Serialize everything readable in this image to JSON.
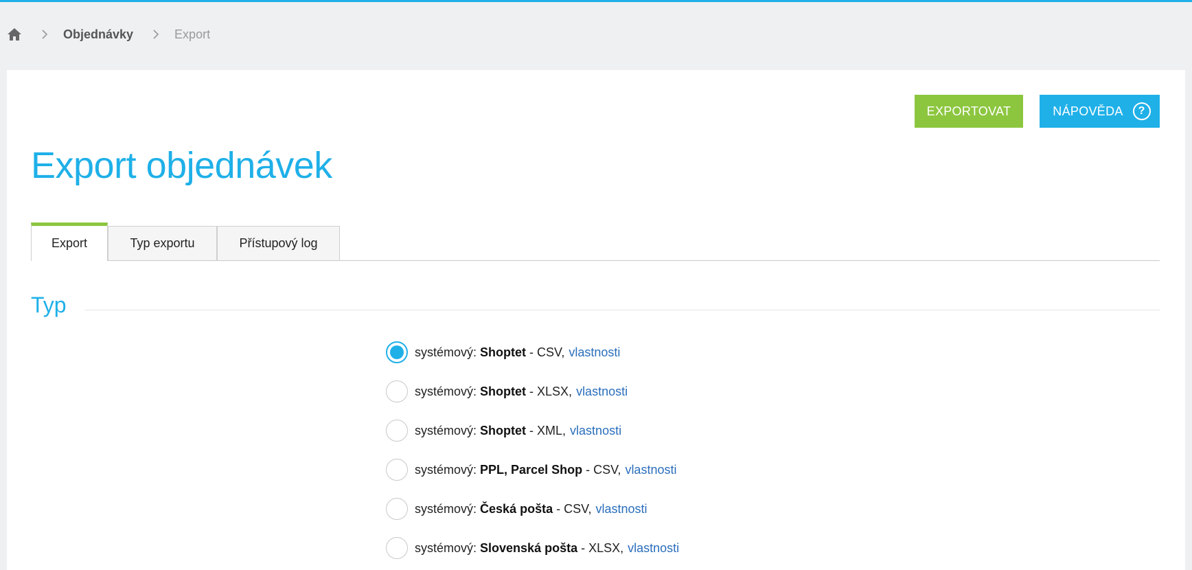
{
  "breadcrumb": {
    "home_icon": "home-icon",
    "items": [
      "Objednávky",
      "Export"
    ]
  },
  "toolbar": {
    "export_label": "EXPORTOVAT",
    "help_label": "NÁPOVĚDA",
    "help_icon": "question-circle-icon"
  },
  "page_title": "Export objednávek",
  "tabs": [
    {
      "label": "Export",
      "active": true
    },
    {
      "label": "Typ exportu",
      "active": false
    },
    {
      "label": "Přístupový log",
      "active": false
    }
  ],
  "section": {
    "title": "Typ",
    "options": [
      {
        "prefix": "systémový:",
        "name": "Shoptet",
        "format": "- CSV,",
        "link": "vlastnosti",
        "selected": true
      },
      {
        "prefix": "systémový:",
        "name": "Shoptet",
        "format": "- XLSX,",
        "link": "vlastnosti",
        "selected": false
      },
      {
        "prefix": "systémový:",
        "name": "Shoptet",
        "format": "- XML,",
        "link": "vlastnosti",
        "selected": false
      },
      {
        "prefix": "systémový:",
        "name": "PPL, Parcel Shop",
        "format": "- CSV,",
        "link": "vlastnosti",
        "selected": false
      },
      {
        "prefix": "systémový:",
        "name": "Česká pošta",
        "format": "- CSV,",
        "link": "vlastnosti",
        "selected": false
      },
      {
        "prefix": "systémový:",
        "name": "Slovenská pošta",
        "format": "- XLSX,",
        "link": "vlastnosti",
        "selected": false
      }
    ]
  },
  "colors": {
    "accent_blue": "#1fb0e8",
    "accent_green": "#8cc63f",
    "link_blue": "#2a6ebb"
  }
}
